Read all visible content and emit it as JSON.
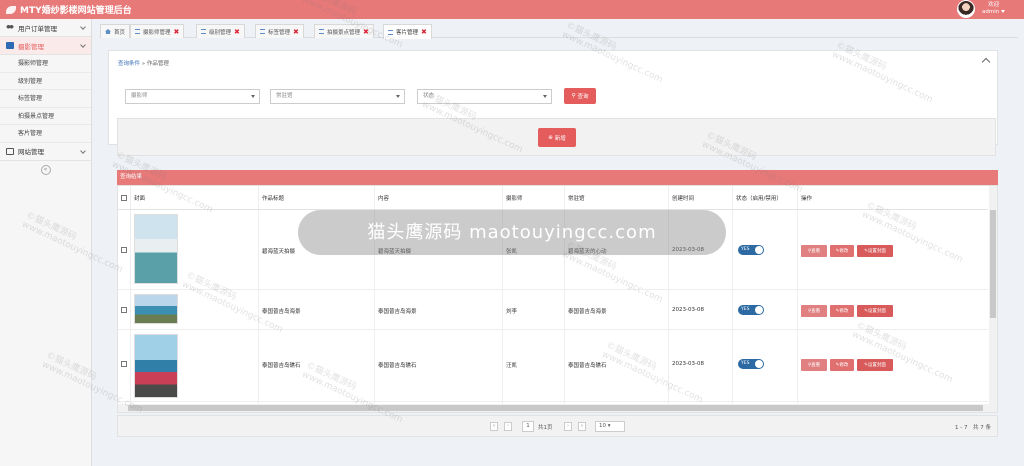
{
  "header": {
    "title": "MTY婚纱影楼网站管理后台",
    "user_greeting": "欢迎",
    "username": "admin"
  },
  "sidebar": {
    "groups": [
      {
        "label": "用户订单管理"
      },
      {
        "label": "摄影管理",
        "items": [
          "摄影师管理",
          "级别管理",
          "标签管理",
          "拍摄景点管理",
          "客片管理"
        ]
      },
      {
        "label": "网站管理"
      }
    ]
  },
  "tabs": [
    {
      "label": "首页"
    },
    {
      "label": "摄影师管理"
    },
    {
      "label": "级别管理"
    },
    {
      "label": "标签管理"
    },
    {
      "label": "拍摄景点管理"
    },
    {
      "label": "客片管理"
    }
  ],
  "search": {
    "crumb_link": "查询条件",
    "crumb_current": "» 作品管理",
    "photographer_placeholder": "摄影师",
    "venue_placeholder": "常驻馆",
    "status_placeholder": "状态",
    "search_label": "查询"
  },
  "add_label": "新增",
  "results": {
    "title": "查询结果",
    "columns": [
      "封面",
      "作品标题",
      "内容",
      "摄影师",
      "常驻馆",
      "创建时间",
      "状态（启用/禁用）",
      "操作"
    ],
    "rows": [
      {
        "title": "碧海蓝天拍摄",
        "content": "碧海蓝天拍摄",
        "photographer": "张凯",
        "venue": "碧海蓝天的心动",
        "date": "2023-03-08",
        "status": "YES"
      },
      {
        "title": "泰国普吉岛海景",
        "content": "泰国普吉岛海景",
        "photographer": "刘李",
        "venue": "泰国普吉岛海景",
        "date": "2023-03-08",
        "status": "YES"
      },
      {
        "title": "泰国普吉岛礁石",
        "content": "泰国普吉岛礁石",
        "photographer": "汪凯",
        "venue": "泰国普吉岛礁石",
        "date": "2023-03-08",
        "status": "YES"
      }
    ],
    "actions": {
      "view": "查看",
      "edit": "修改",
      "cover": "设置封面"
    }
  },
  "pager": {
    "page": "1",
    "total_pages": "共1页",
    "page_size": "10",
    "summary": "1 - 7　共 7 条"
  },
  "overlay_text": "猫头鹰源码 maotouyingcc.com",
  "watermark": {
    "line1": "©猫头鹰源码",
    "line2": "www.maotouyingcc.com"
  },
  "colors": {
    "brand": "#e87979",
    "button": "#e45c5c",
    "toggle": "#2d6aa4",
    "link": "#3b6fb6"
  }
}
